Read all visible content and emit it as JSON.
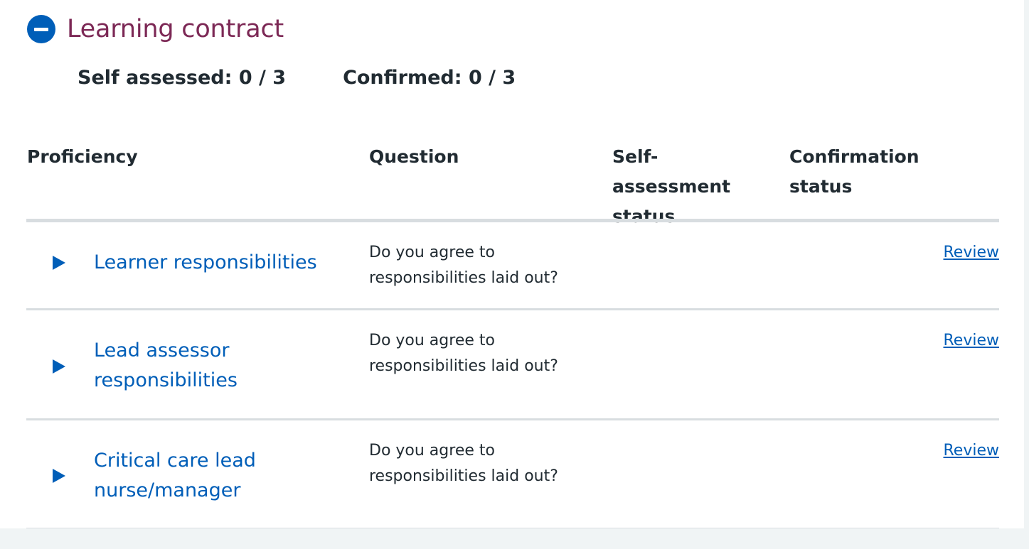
{
  "section": {
    "title": "Learning contract",
    "toggle_icon": "minus-circle-icon"
  },
  "summary": {
    "self_label": "Self assessed:",
    "self_value": "0 / 3",
    "confirmed_label": "Confirmed:",
    "confirmed_value": "0 / 3"
  },
  "table": {
    "headers": {
      "proficiency": "Proficiency",
      "question": "Question",
      "self_status": "Self-assessment status",
      "confirmation_status": "Confirmation status"
    },
    "rows": [
      {
        "proficiency": "Learner responsibilities",
        "question": "Do you agree to responsibilities laid out?",
        "review_label": "Review"
      },
      {
        "proficiency": "Lead assessor responsibilities",
        "question": "Do you agree to responsibilities laid out?",
        "review_label": "Review"
      },
      {
        "proficiency": "Critical care lead nurse/manager",
        "question": "Do you agree to responsibilities laid out?",
        "review_label": "Review"
      }
    ]
  },
  "colors": {
    "brand_blue": "#005eb8",
    "section_title": "#7c2855",
    "text": "#212b32",
    "divider": "#d8dde0",
    "page_background": "#f0f4f5"
  }
}
